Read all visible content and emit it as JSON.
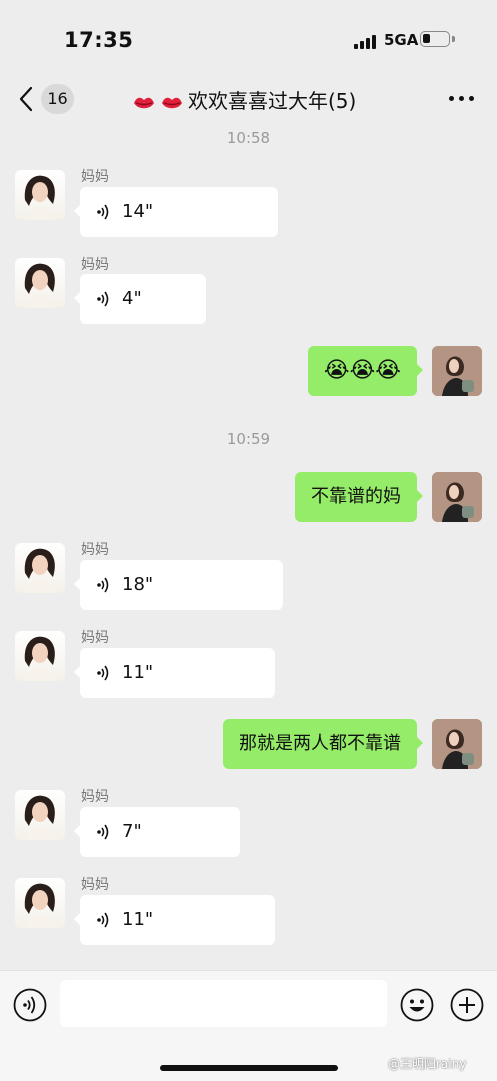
{
  "status_bar": {
    "time": "17:35",
    "network": "5GA"
  },
  "nav": {
    "unread_count": "16",
    "title": "欢欢喜喜过大年(5)"
  },
  "messages": {
    "t1": "10:58",
    "m1": {
      "sender": "妈妈",
      "duration": "14\""
    },
    "m2": {
      "sender": "妈妈",
      "duration": "4\""
    },
    "m3": {
      "text": "😭😭😭"
    },
    "t2": "10:59",
    "m4": {
      "text": "不靠谱的妈"
    },
    "m5": {
      "sender": "妈妈",
      "duration": "18\""
    },
    "m6": {
      "sender": "妈妈",
      "duration": "11\""
    },
    "m7": {
      "text": "那就是两人都不靠谱"
    },
    "m8": {
      "sender": "妈妈",
      "duration": "7\""
    },
    "m9": {
      "sender": "妈妈",
      "duration": "11\""
    }
  },
  "watermark": "@王明阳rainy",
  "colors": {
    "background": "#ededed",
    "outgoing_bubble": "#95ec69",
    "incoming_bubble": "#ffffff"
  },
  "icons": [
    "back-chevron-icon",
    "lips-icon",
    "more-icon",
    "voice-wave-icon",
    "voice-input-icon",
    "emoji-icon",
    "plus-icon"
  ]
}
